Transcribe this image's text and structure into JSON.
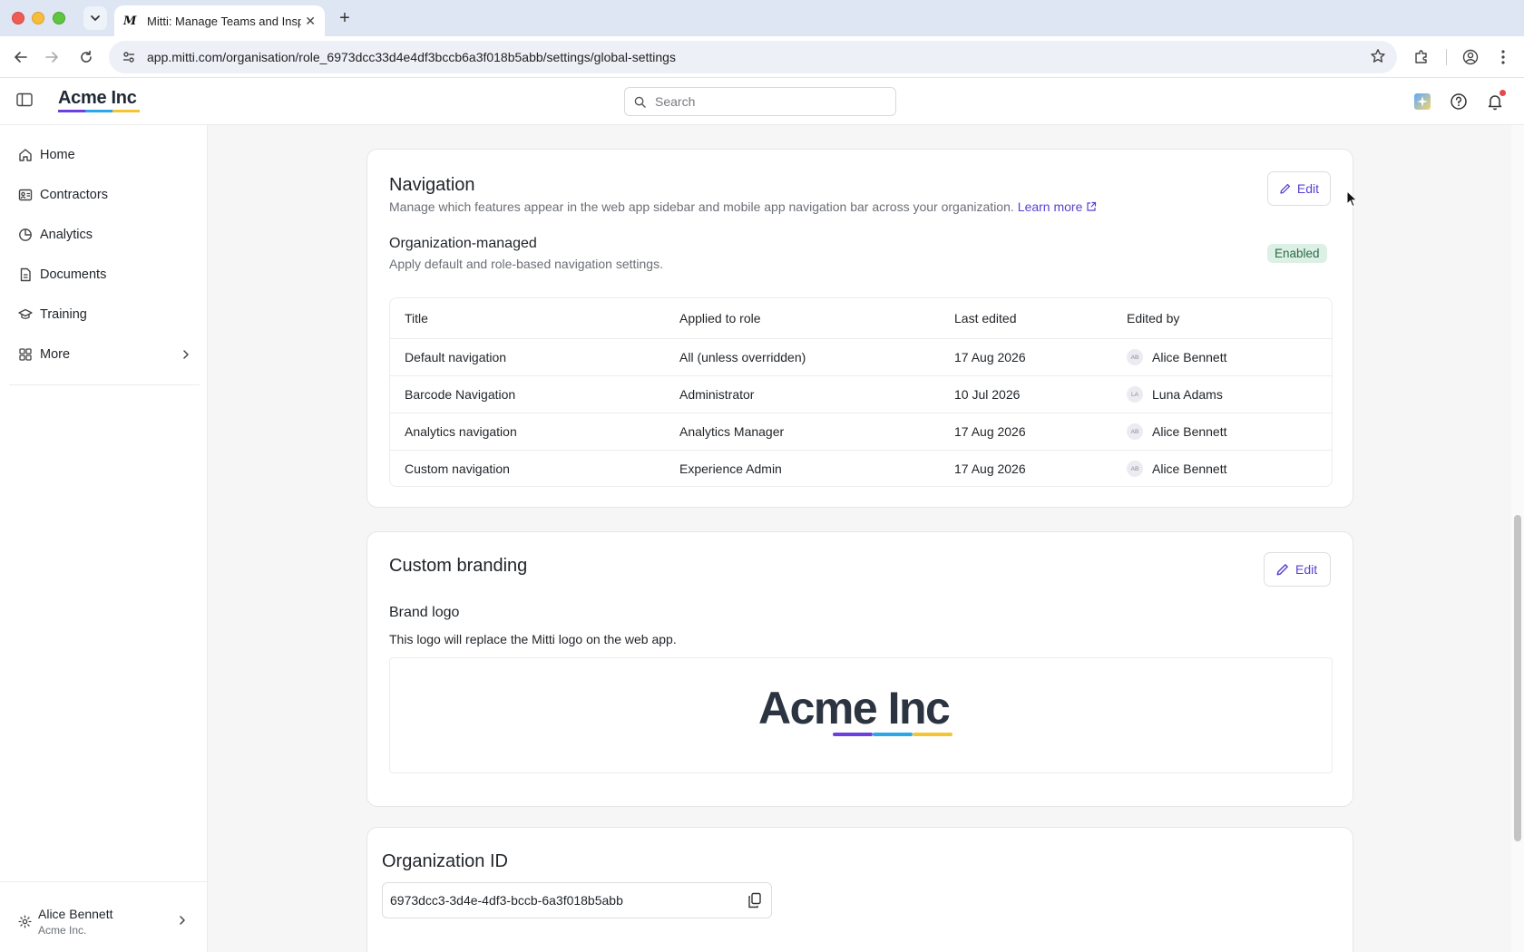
{
  "browser": {
    "tab_title": "Mitti: Manage Teams and Inspections",
    "tab_favicon": "M",
    "url": "app.mitti.com/organisation/role_6973dcc33d4e4df3bccb6a3f018b5abb/settings/global-settings"
  },
  "header": {
    "brand": "Acme Inc",
    "search_placeholder": "Search",
    "brand_colors": [
      "#6b3fe0",
      "#2aa7e8",
      "#f2c531"
    ]
  },
  "sidebar": {
    "items": [
      {
        "label": "Home",
        "icon": "home-icon"
      },
      {
        "label": "Contractors",
        "icon": "contacts-icon"
      },
      {
        "label": "Analytics",
        "icon": "pie-chart-icon"
      },
      {
        "label": "Documents",
        "icon": "document-icon"
      },
      {
        "label": "Training",
        "icon": "graduation-cap-icon"
      },
      {
        "label": "More",
        "icon": "grid-icon"
      }
    ],
    "user": {
      "name": "Alice Bennett",
      "org": "Acme Inc."
    }
  },
  "navigation_card": {
    "title": "Navigation",
    "description": "Manage which features appear in the web app sidebar and mobile app navigation bar across your organization.",
    "learn_more": "Learn more",
    "edit_label": "Edit",
    "org_managed_title": "Organization-managed",
    "org_managed_desc": "Apply default and role-based navigation settings.",
    "status": "Enabled",
    "columns": [
      "Title",
      "Applied to role",
      "Last edited",
      "Edited by"
    ],
    "rows": [
      {
        "title": "Default navigation",
        "role": "All (unless overridden)",
        "edited": "17 Aug 2026",
        "initials": "AB",
        "by": "Alice Bennett"
      },
      {
        "title": "Barcode Navigation",
        "role": "Administrator",
        "edited": "10 Jul 2026",
        "initials": "LA",
        "by": "Luna Adams"
      },
      {
        "title": "Analytics navigation",
        "role": "Analytics Manager",
        "edited": "17 Aug 2026",
        "initials": "AB",
        "by": "Alice Bennett"
      },
      {
        "title": "Custom navigation",
        "role": "Experience Admin",
        "edited": "17 Aug 2026",
        "initials": "AB",
        "by": "Alice Bennett"
      }
    ]
  },
  "branding_card": {
    "title": "Custom branding",
    "edit_label": "Edit",
    "logo_heading": "Brand logo",
    "logo_desc": "This logo will replace the Mitti logo on the web app.",
    "logo_text": "Acme Inc"
  },
  "org_id_card": {
    "title": "Organization ID",
    "value": "6973dcc3-3d4e-4df3-bccb-6a3f018b5abb"
  }
}
